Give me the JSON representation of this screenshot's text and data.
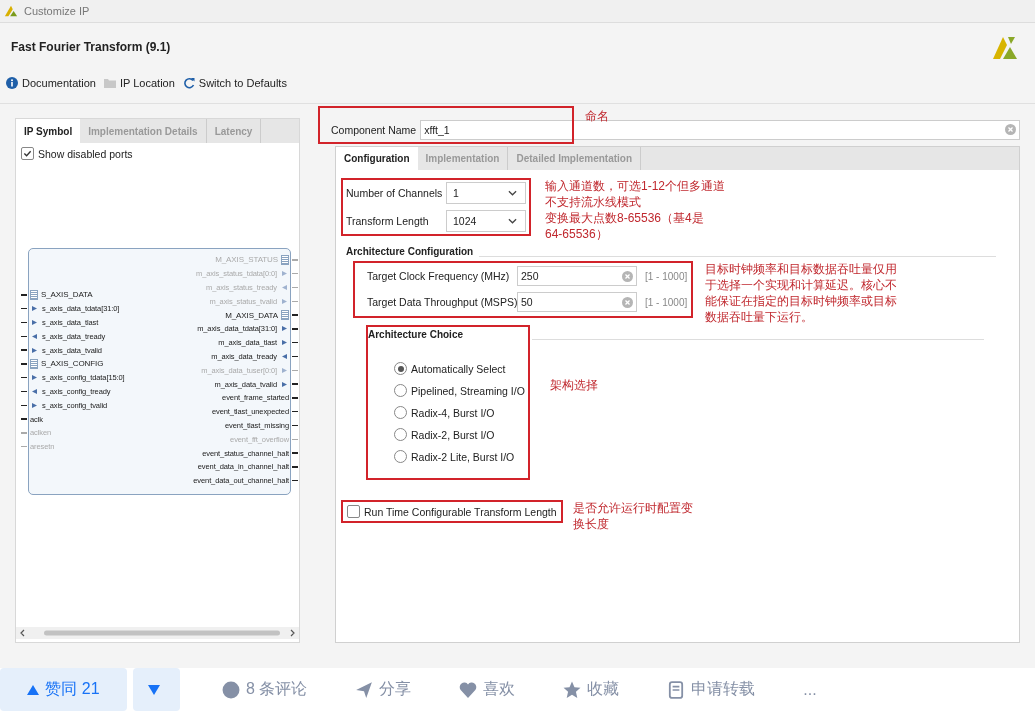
{
  "window": {
    "title": "Customize IP"
  },
  "header": {
    "title": "Fast Fourier Transform (9.1)"
  },
  "toolbar": [
    {
      "label": "Documentation",
      "kind": "info"
    },
    {
      "label": "IP Location",
      "kind": "folder"
    },
    {
      "label": "Switch to Defaults",
      "kind": "refresh"
    }
  ],
  "left_panel": {
    "tabs": [
      {
        "label": "IP Symbol",
        "selected": true
      },
      {
        "label": "Implementation Details",
        "selected": false
      },
      {
        "label": "Latency",
        "selected": false
      }
    ],
    "show_disabled_ports": {
      "label": "Show disabled ports",
      "checked": true
    },
    "symbol": {
      "left_ports": [
        {
          "label": "S_AXIS_DATA",
          "kind": "bus",
          "disabled": false
        },
        {
          "label": "s_axis_data_tdata[31:0]",
          "kind": "in",
          "disabled": false
        },
        {
          "label": "s_axis_data_tlast",
          "kind": "in",
          "disabled": false
        },
        {
          "label": "s_axis_data_tready",
          "kind": "out",
          "disabled": false
        },
        {
          "label": "s_axis_data_tvalid",
          "kind": "in",
          "disabled": false
        },
        {
          "label": "S_AXIS_CONFIG",
          "kind": "bus",
          "disabled": false
        },
        {
          "label": "s_axis_config_tdata[15:0]",
          "kind": "in",
          "disabled": false
        },
        {
          "label": "s_axis_config_tready",
          "kind": "out",
          "disabled": false
        },
        {
          "label": "s_axis_config_tvalid",
          "kind": "in",
          "disabled": false
        },
        {
          "label": "aclk",
          "kind": "plain",
          "disabled": false
        },
        {
          "label": "aclken",
          "kind": "plain",
          "disabled": true
        },
        {
          "label": "aresetn",
          "kind": "reset",
          "disabled": true
        }
      ],
      "right_ports": [
        {
          "label": "M_AXIS_STATUS",
          "kind": "bus",
          "disabled": true
        },
        {
          "label": "m_axis_status_tdata[0:0]",
          "kind": "out",
          "disabled": true
        },
        {
          "label": "m_axis_status_tready",
          "kind": "in",
          "disabled": true
        },
        {
          "label": "m_axis_status_tvalid",
          "kind": "out",
          "disabled": true
        },
        {
          "label": "M_AXIS_DATA",
          "kind": "bus",
          "disabled": false
        },
        {
          "label": "m_axis_data_tdata[31:0]",
          "kind": "out",
          "disabled": false
        },
        {
          "label": "m_axis_data_tlast",
          "kind": "out",
          "disabled": false
        },
        {
          "label": "m_axis_data_tready",
          "kind": "in",
          "disabled": false
        },
        {
          "label": "m_axis_data_tuser[0:0]",
          "kind": "out",
          "disabled": true
        },
        {
          "label": "m_axis_data_tvalid",
          "kind": "out",
          "disabled": false
        },
        {
          "label": "event_frame_started",
          "kind": "plain",
          "disabled": false
        },
        {
          "label": "event_tlast_unexpected",
          "kind": "plain",
          "disabled": false
        },
        {
          "label": "event_tlast_missing",
          "kind": "plain",
          "disabled": false
        },
        {
          "label": "event_fft_overflow",
          "kind": "plain",
          "disabled": true
        },
        {
          "label": "event_status_channel_halt",
          "kind": "plain",
          "disabled": false
        },
        {
          "label": "event_data_in_channel_halt",
          "kind": "plain",
          "disabled": false
        },
        {
          "label": "event_data_out_channel_halt",
          "kind": "plain",
          "disabled": false
        }
      ]
    }
  },
  "component_name": {
    "label": "Component Name",
    "value": "xfft_1"
  },
  "config_tabs": [
    {
      "label": "Configuration",
      "selected": true
    },
    {
      "label": "Implementation",
      "selected": false
    },
    {
      "label": "Detailed Implementation",
      "selected": false
    }
  ],
  "selects": [
    {
      "label": "Number of Channels",
      "value": "1"
    },
    {
      "label": "Transform Length",
      "value": "1024"
    }
  ],
  "architecture_configuration": {
    "title": "Architecture Configuration",
    "fields": [
      {
        "label": "Target Clock Frequency (MHz)",
        "value": "250",
        "range": "[1 - 1000]"
      },
      {
        "label": "Target Data Throughput (MSPS)",
        "value": "50",
        "range": "[1 - 1000]"
      }
    ]
  },
  "architecture_choice": {
    "title": "Architecture Choice",
    "options": [
      {
        "label": "Automatically Select",
        "selected": true
      },
      {
        "label": "Pipelined, Streaming I/O",
        "selected": false
      },
      {
        "label": "Radix-4, Burst I/O",
        "selected": false
      },
      {
        "label": "Radix-2, Burst I/O",
        "selected": false
      },
      {
        "label": "Radix-2 Lite, Burst I/O",
        "selected": false
      }
    ]
  },
  "run_time_config": {
    "label": "Run Time Configurable Transform Length",
    "checked": false
  },
  "annotations": [
    "命名",
    [
      "输入通道数，可选1-12个但多通道",
      "不支持流水线模式",
      "变换最大点数8-65536（基4是",
      "64-65536）"
    ],
    "目标时钟频率和目标数据吞吐量仅用于选择一个实现和计算延迟。核心不能保证在指定的目标时钟频率或目标数据吞吐量下运行。",
    "架构选择",
    "是否允许运行时配置变换长度"
  ],
  "action_bar": {
    "upvote": "赞同 21",
    "items": [
      {
        "label": "8 条评论",
        "kind": "comment"
      },
      {
        "label": "分享",
        "kind": "share"
      },
      {
        "label": "喜欢",
        "kind": "heart"
      },
      {
        "label": "收藏",
        "kind": "star"
      },
      {
        "label": "申请转载",
        "kind": "doc"
      },
      {
        "label": "...",
        "kind": "more"
      }
    ]
  }
}
